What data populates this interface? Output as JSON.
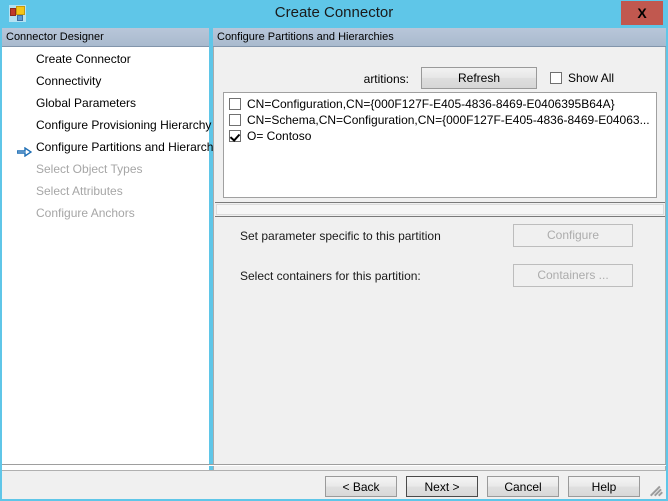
{
  "window": {
    "title": "Create Connector",
    "icon": "connector-app-icon",
    "close_label": "X",
    "accent_titlebar": "#5fc6e8",
    "close_button_color": "#c1584f"
  },
  "left_panel": {
    "header": "Connector Designer",
    "items": [
      {
        "label": "Create Connector",
        "state": "normal",
        "current": false
      },
      {
        "label": "Connectivity",
        "state": "normal",
        "current": false
      },
      {
        "label": "Global Parameters",
        "state": "normal",
        "current": false
      },
      {
        "label": "Configure Provisioning Hierarchy",
        "state": "normal",
        "current": false
      },
      {
        "label": "Configure Partitions and Hierarchies",
        "state": "normal",
        "current": true
      },
      {
        "label": "Select Object Types",
        "state": "disabled",
        "current": false
      },
      {
        "label": "Select Attributes",
        "state": "disabled",
        "current": false
      },
      {
        "label": "Configure Anchors",
        "state": "disabled",
        "current": false
      }
    ],
    "current_arrow_color": "#1f6fb5"
  },
  "right_panel": {
    "header": "Configure Partitions and Hierarchies",
    "partitions_label": "artitions:",
    "refresh_label": "Refresh",
    "show_all_label": "Show All",
    "show_all_checked": false,
    "partitions": [
      {
        "label": "CN=Configuration,CN={000F127F-E405-4836-8469-E0406395B64A}",
        "checked": false
      },
      {
        "label": "CN=Schema,CN=Configuration,CN={000F127F-E405-4836-8469-E04063...",
        "checked": false
      },
      {
        "label": "O= Contoso",
        "checked": true
      }
    ],
    "configure_row_label": "Set parameter specific to this partition",
    "configure_button_label": "Configure",
    "configure_button_enabled": false,
    "containers_row_label": "Select containers for this partition:",
    "containers_button_label": "Containers ...",
    "containers_button_enabled": false
  },
  "bottom_bar": {
    "back_label": "< Back",
    "next_label": "Next  >",
    "cancel_label": "Cancel",
    "help_label": "Help"
  }
}
